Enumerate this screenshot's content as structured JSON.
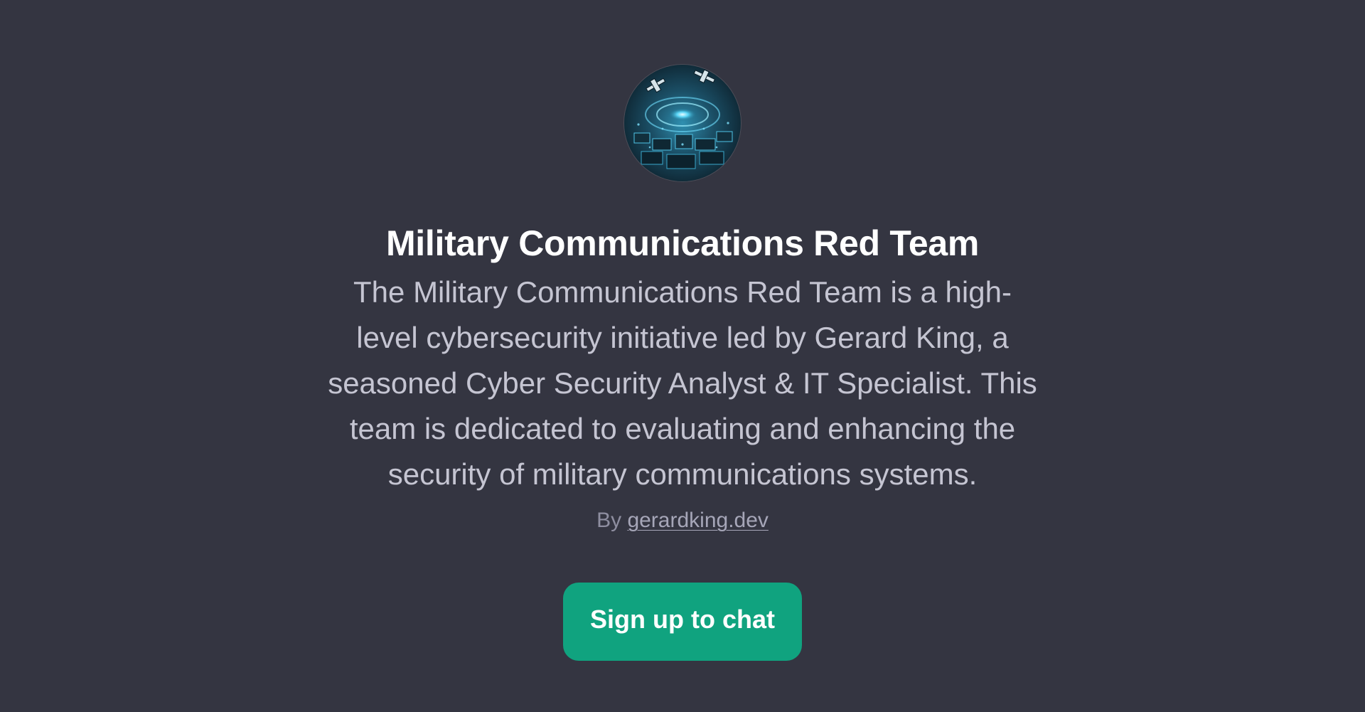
{
  "gpt": {
    "name": "Military Communications Red Team",
    "description": "The Military Communications Red Team is a high-level cybersecurity initiative led by Gerard King, a seasoned Cyber Security Analyst & IT Specialist. This team is dedicated to evaluating and enhancing the security of military communications systems.",
    "byline_prefix": "By",
    "author_link": "gerardking.dev",
    "avatar_icon": "cyber-command-center-avatar"
  },
  "cta": {
    "label": "Sign up to chat"
  },
  "colors": {
    "background": "#343541",
    "accent": "#10a37f",
    "title": "#ffffff",
    "description": "#c5c5d2"
  }
}
